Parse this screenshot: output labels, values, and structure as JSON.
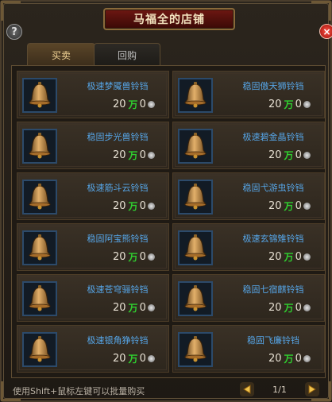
{
  "window": {
    "title": "马福全的店铺",
    "help_label": "?",
    "close_label": "×"
  },
  "tabs": [
    {
      "label": "买卖",
      "active": true
    },
    {
      "label": "回购",
      "active": false
    }
  ],
  "items": [
    {
      "name": "极速梦魇兽铃铛",
      "price_amount": "20",
      "price_unit": "万",
      "price_extra": "0"
    },
    {
      "name": "稳固傲天狮铃铛",
      "price_amount": "20",
      "price_unit": "万",
      "price_extra": "0"
    },
    {
      "name": "稳固步光兽铃铛",
      "price_amount": "20",
      "price_unit": "万",
      "price_extra": "0"
    },
    {
      "name": "极速碧金晶铃铛",
      "price_amount": "20",
      "price_unit": "万",
      "price_extra": "0"
    },
    {
      "name": "极速筋斗云铃铛",
      "price_amount": "20",
      "price_unit": "万",
      "price_extra": "0"
    },
    {
      "name": "稳固弋游虫铃铛",
      "price_amount": "20",
      "price_unit": "万",
      "price_extra": "0"
    },
    {
      "name": "稳固阿宝熊铃铛",
      "price_amount": "20",
      "price_unit": "万",
      "price_extra": "0"
    },
    {
      "name": "极速玄锦雉铃铛",
      "price_amount": "20",
      "price_unit": "万",
      "price_extra": "0"
    },
    {
      "name": "极速苍穹骊铃铛",
      "price_amount": "20",
      "price_unit": "万",
      "price_extra": "0"
    },
    {
      "name": "稳固七宿麒铃铛",
      "price_amount": "20",
      "price_unit": "万",
      "price_extra": "0"
    },
    {
      "name": "极速银角狰铃铛",
      "price_amount": "20",
      "price_unit": "万",
      "price_extra": "0"
    },
    {
      "name": "稳固飞廉铃铛",
      "price_amount": "20",
      "price_unit": "万",
      "price_extra": "0"
    }
  ],
  "footer": {
    "hint": "使用Shift+鼠标左键可以批量购买",
    "page": "1/1"
  },
  "colors": {
    "item_name": "#56a6e8",
    "currency": "#2fcf2f",
    "title_plate": "#6d1712"
  }
}
